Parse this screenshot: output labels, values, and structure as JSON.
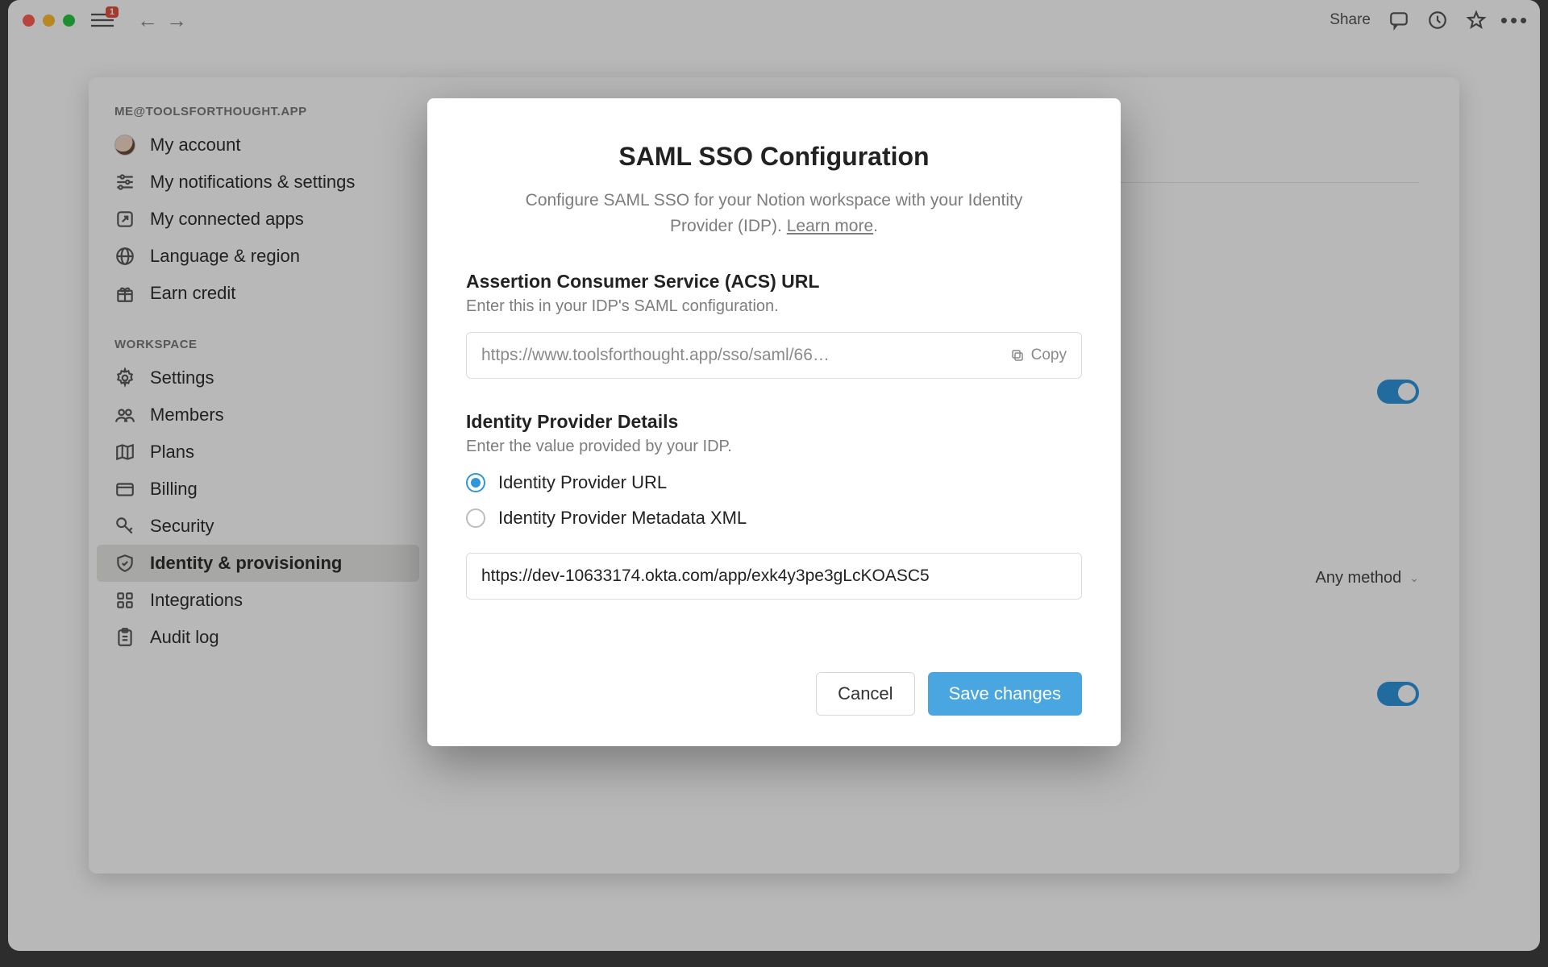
{
  "titlebar": {
    "badge": "1",
    "share_label": "Share"
  },
  "sidebar": {
    "account_heading": "ME@TOOLSFORTHOUGHT.APP",
    "workspace_heading": "WORKSPACE",
    "items_account": [
      {
        "label": "My account"
      },
      {
        "label": "My notifications & settings"
      },
      {
        "label": "My connected apps"
      },
      {
        "label": "Language & region"
      },
      {
        "label": "Earn credit"
      }
    ],
    "items_workspace": [
      {
        "label": "Settings"
      },
      {
        "label": "Members"
      },
      {
        "label": "Plans"
      },
      {
        "label": "Billing"
      },
      {
        "label": "Security"
      },
      {
        "label": "Identity & provisioning"
      },
      {
        "label": "Integrations"
      },
      {
        "label": "Audit log"
      }
    ]
  },
  "main": {
    "login_method_label": "Any method"
  },
  "modal": {
    "title": "SAML SSO Configuration",
    "subtitle_pre": "Configure SAML SSO for your Notion workspace with your Identity Provider (IDP). ",
    "learn_more": "Learn more",
    "subtitle_post": ".",
    "acs": {
      "title": "Assertion Consumer Service (ACS) URL",
      "desc": "Enter this in your IDP's SAML configuration.",
      "value": "https://www.toolsforthought.app/sso/saml/66…",
      "copy_label": "Copy"
    },
    "idp": {
      "title": "Identity Provider Details",
      "desc": "Enter the value provided by your IDP.",
      "option_url": "Identity Provider URL",
      "option_xml": "Identity Provider Metadata XML",
      "url_value": "https://dev-10633174.okta.com/app/exk4y3pe3gLcKOASC5"
    },
    "buttons": {
      "cancel": "Cancel",
      "save": "Save changes"
    }
  }
}
